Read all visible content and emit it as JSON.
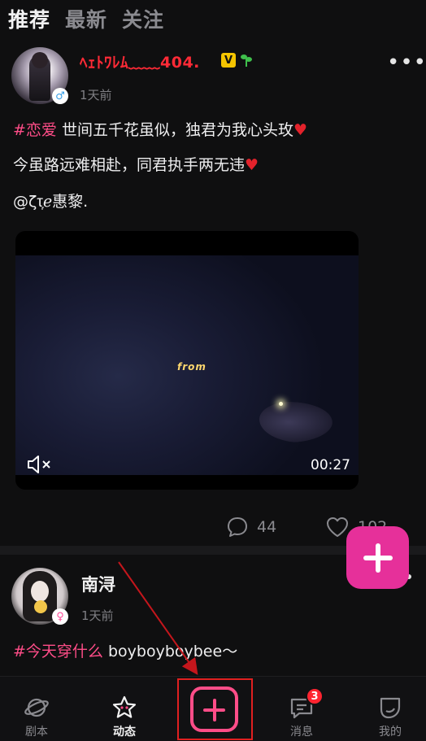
{
  "tabs": [
    {
      "label": "推荐",
      "active": true
    },
    {
      "label": "最新",
      "active": false
    },
    {
      "label": "关注",
      "active": false
    }
  ],
  "post1": {
    "username": "ﾍｪﾄﾜﾚﾑ﹏﹏404.",
    "vip_icon": "V",
    "gender_icon": "♂",
    "time": "1天前",
    "hashtag": "#恋爱",
    "line1_text": " 世间五千花虽似，独君为我心头玫",
    "line2_text": "今虽路远难相赴，同君执手两无违",
    "line3_text": "@ζτ᷊᷊ℯ惠黎.",
    "heart_icon": "♥",
    "video": {
      "overlay_text": "from",
      "duration": "00:27"
    },
    "comments": "44",
    "likes": "102"
  },
  "post2": {
    "username": "南浔",
    "gender_icon": "♀",
    "time": "1天前",
    "hashtag": "#今天穿什么",
    "text": " boyboyboybee～"
  },
  "bottom_nav": {
    "items": [
      {
        "label": "剧本",
        "icon": "planet-icon",
        "active": false
      },
      {
        "label": "动态",
        "icon": "star-icon",
        "active": true
      },
      {
        "label": "消息",
        "icon": "chat-icon",
        "active": false,
        "badge": "3"
      },
      {
        "label": "我的",
        "icon": "leaf-icon",
        "active": false
      }
    ]
  },
  "colors": {
    "accent": "#ff4d88",
    "fab": "#e6309a",
    "annotation": "#e02020"
  }
}
